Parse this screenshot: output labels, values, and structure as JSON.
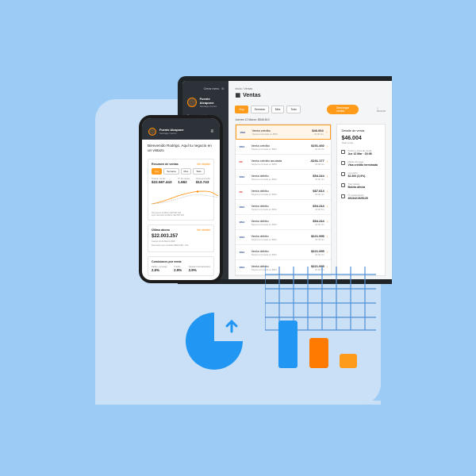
{
  "laptop": {
    "sidebar": {
      "top_label": "Cerrar menú",
      "store_name": "Fuente Alcapone",
      "store_sub": "Santiago Centro",
      "items": [
        "Resumen rápido",
        "",
        "",
        ""
      ],
      "footer": ""
    },
    "breadcrumb": "Inicio / Ventas",
    "title": "Ventas",
    "filters": [
      "Hoy",
      "Semana",
      "Mes",
      "Todo"
    ],
    "download_label": "Descargar ventas",
    "search_placeholder": "Buscar",
    "date_label": "Jueves 12 Marzo: $546.813",
    "rows": [
      {
        "brand": "VISA",
        "title": "Venta crédito",
        "sub": "Tarjeta terminada en 8861",
        "amount": "$46.004",
        "time": "20:08 hrs"
      },
      {
        "brand": "VISA",
        "title": "Venta crédito",
        "sub": "Tarjeta terminada en 8861",
        "amount": "$191.492",
        "time": "20:02 hrs"
      },
      {
        "brand": "MC",
        "title": "Venta crédito anulada",
        "sub": "Tarjeta terminada en 8861",
        "amount": "-$191.177",
        "time": "20:00 hrs"
      },
      {
        "brand": "VISA",
        "title": "Venta débito",
        "sub": "Tarjeta terminada en 8861",
        "amount": "$54.244",
        "time": "20:00 hrs"
      },
      {
        "brand": "MC",
        "title": "Venta débito",
        "sub": "Tarjeta terminada en 8861",
        "amount": "$87.814",
        "time": "20:00 hrs"
      },
      {
        "brand": "VISA",
        "title": "Venta débito",
        "sub": "Tarjeta terminada en 8861",
        "amount": "$54.244",
        "time": "20:00 hrs"
      },
      {
        "brand": "VISA",
        "title": "Venta débito",
        "sub": "Tarjeta terminada en 8861",
        "amount": "$54.244",
        "time": "20:00 hrs"
      },
      {
        "brand": "VISA",
        "title": "Venta débito",
        "sub": "Tarjeta terminada en 8861",
        "amount": "$221.995",
        "time": "20:00 hrs"
      },
      {
        "brand": "VISA",
        "title": "Venta débito",
        "sub": "Tarjeta terminada en 8861",
        "amount": "$221.995",
        "time": "20:00 hrs"
      },
      {
        "brand": "VISA",
        "title": "Venta débito",
        "sub": "Tarjeta terminada en 8861",
        "amount": "$221.995",
        "time": "20:00 hrs"
      }
    ],
    "detail": {
      "title": "Detalle de venta",
      "amount": "$46.004",
      "amount_sub": "Total venta",
      "items": [
        {
          "label": "Fecha y hora de venta",
          "value": "Jue 12 Mar · 20:08"
        },
        {
          "label": "Medio de pago",
          "value": "Visa crédito terminada"
        },
        {
          "label": "Comisión",
          "value": "$2.300 (3,9%)"
        },
        {
          "label": "Tipo boleta",
          "value": "Boleta afecta"
        },
        {
          "label": "N° autorización",
          "value": "4913421525125"
        }
      ]
    }
  },
  "phone": {
    "store_name": "Fuente Alcapone",
    "store_sub": "Santiago Centro",
    "welcome": "Bienvenido Rodrigo. Aquí tu negocio en un vistazo",
    "sales_summary": {
      "title": "Resumen de ventas",
      "link": "Ver detalle",
      "filters": [
        "Hoy",
        "Semana",
        "Mes",
        "Todo"
      ],
      "stats": [
        {
          "label": "Total en ventas",
          "value": "$22.567.443"
        },
        {
          "label": "N° de ventas",
          "value": "1.662"
        },
        {
          "label": "Venta promedio",
          "value": "$13.743"
        }
      ],
      "legend": [
        "Hoy jueves 12 Marzo: $22.567.443",
        "Ayer miércoles 11 Marzo: $22.567.443"
      ]
    },
    "deposit": {
      "title": "Último abono",
      "link": "Ver detalle",
      "amount": "$22.003.257",
      "date": "Jueves 12 de Marzo 2022",
      "note": "Descuento por comisión $564.186 + IVA"
    },
    "fees": {
      "title": "Comisiones por venta",
      "items": [
        {
          "label": "Débito y prepago",
          "value": "2.5%"
        },
        {
          "label": "Crédito",
          "value": "2.9%"
        },
        {
          "label": "Tarjetas Internacionales",
          "value": "2.9%"
        }
      ]
    }
  },
  "colors": {
    "background": "#9ccbf5",
    "accent": "#ff9b1a",
    "blue": "#2196f3",
    "orange": "#ff7a00",
    "dark": "#2c3238"
  },
  "icons": [
    "pie-chart-icon",
    "upload-arrow-icon",
    "grid-icon",
    "bar-chart-icon"
  ]
}
